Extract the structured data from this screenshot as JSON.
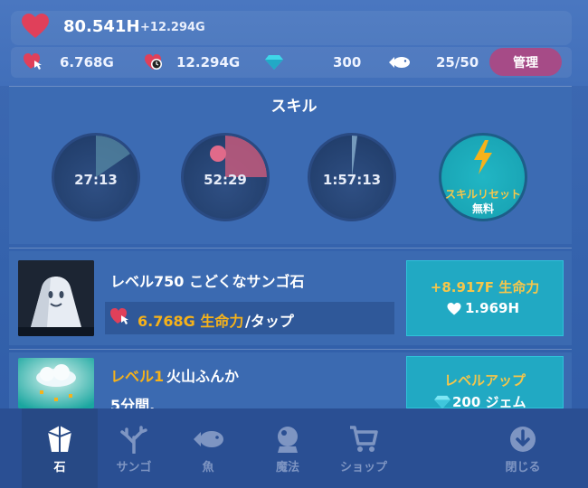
{
  "header": {
    "main_value": "80.541H",
    "main_rate": "+12.294G",
    "tap_value": "6.768G",
    "idle_value": "12.294G",
    "gems": "300",
    "fish": "25/50",
    "manage_label": "管理"
  },
  "skills": {
    "title": "スキル",
    "timers": [
      "27:13",
      "52:29",
      "1:57:13"
    ],
    "reset_label": "スキルリセット",
    "reset_cost": "無料"
  },
  "items": [
    {
      "title": "レベル750 こどくなサンゴ石",
      "desc_value": "6.768G 生命力",
      "desc_suffix": "/タップ",
      "button_top": "+8.917F 生命力",
      "button_bottom": "1.969H"
    },
    {
      "title_level": "レベル1",
      "title_name": " 火山ふんか",
      "desc": "5分間,",
      "button_top": "レベルアップ",
      "button_bottom": "200 ジェム"
    }
  ],
  "tabs": [
    {
      "label": "石",
      "icon": "stone-icon",
      "active": true
    },
    {
      "label": "サンゴ",
      "icon": "coral-icon"
    },
    {
      "label": "魚",
      "icon": "fish-icon"
    },
    {
      "label": "魔法",
      "icon": "crystal-ball-icon"
    },
    {
      "label": "ショップ",
      "icon": "cart-icon"
    },
    {
      "label": "閉じる",
      "icon": "close-down-icon"
    }
  ],
  "colors": {
    "accent": "#f6b21a",
    "manage": "#a64b87",
    "button": "#21a9c3",
    "heart": "#e0405a"
  }
}
